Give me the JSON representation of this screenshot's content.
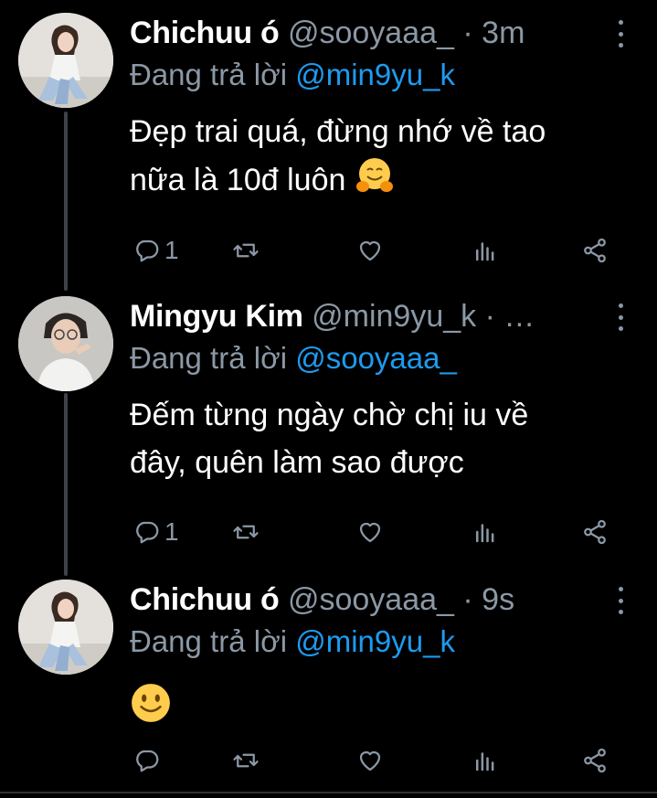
{
  "theme": {
    "background": "#000000",
    "text": "#ffffff",
    "muted": "#8b98a5",
    "link": "#1d9bf0",
    "thread_line": "#3d4349"
  },
  "tweets": [
    {
      "name": "Chichuu ó",
      "handle": "@sooyaaa_",
      "separator": "·",
      "time": "3m",
      "reply_prefix": "Đang trả lời",
      "reply_to": "@min9yu_k",
      "text_line1": "Đẹp trai quá, đừng nhớ về tao",
      "text_line2": "nữa là 10đ luôn",
      "emoji": "hugging-face",
      "reply_count": "1",
      "avatar": "avatar-woman"
    },
    {
      "name": "Mingyu Kim",
      "handle": "@min9yu_k",
      "separator": "·",
      "time": "…",
      "reply_prefix": "Đang trả lời",
      "reply_to": "@sooyaaa_",
      "text_line1": "Đếm từng ngày chờ chị iu về",
      "text_line2": "đây, quên làm sao được",
      "reply_count": "1",
      "avatar": "avatar-man"
    },
    {
      "name": "Chichuu ó",
      "handle": "@sooyaaa_",
      "separator": "·",
      "time": "9s",
      "reply_prefix": "Đang trả lời",
      "reply_to": "@min9yu_k",
      "emoji": "slightly-smiling-face",
      "reply_count": "",
      "avatar": "avatar-woman"
    }
  ],
  "icons": [
    "reply-icon",
    "retweet-icon",
    "like-icon",
    "analytics-icon",
    "share-icon",
    "more-options-icon"
  ]
}
